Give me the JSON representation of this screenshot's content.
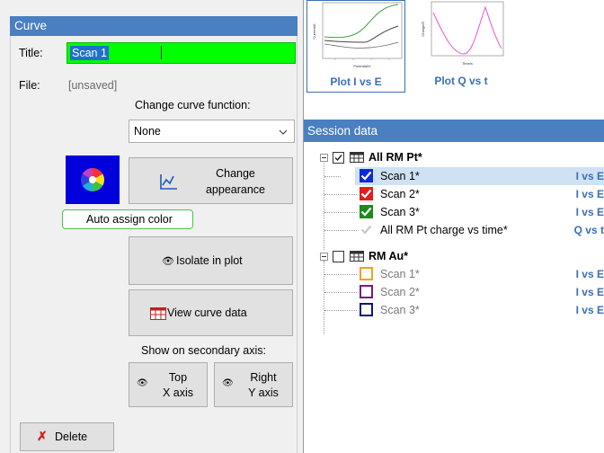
{
  "thumbnails": [
    {
      "label": "Plot I vs E",
      "xlabel": "Potential/V",
      "ylabel": "Current/A"
    },
    {
      "label": "Plot Q vs t",
      "xlabel": "Time/s",
      "ylabel": "Charge/C"
    }
  ],
  "session": {
    "header": "Session data",
    "groups": [
      {
        "name": "All RM Pt*",
        "checked": true,
        "items": [
          {
            "name": "Scan 1*",
            "plot": "I vs E",
            "color": "#0b2bd6",
            "checked": true,
            "selected": true,
            "dim": false
          },
          {
            "name": "Scan 2*",
            "plot": "I vs E",
            "color": "#e41c1c",
            "checked": true,
            "selected": false,
            "dim": false
          },
          {
            "name": "Scan 3*",
            "plot": "I vs E",
            "color": "#1c8a1c",
            "checked": true,
            "selected": false,
            "dim": false
          },
          {
            "name": "All RM Pt charge vs time*",
            "plot": "Q vs t",
            "color": "#c8c8c8",
            "checked": true,
            "selected": false,
            "dim": false
          }
        ]
      },
      {
        "name": "RM Au*",
        "checked": false,
        "items": [
          {
            "name": "Scan 1*",
            "plot": "I vs E",
            "color": "#f0a020",
            "checked": false,
            "selected": false,
            "dim": true
          },
          {
            "name": "Scan 2*",
            "plot": "I vs E",
            "color": "#7a1c7a",
            "checked": false,
            "selected": false,
            "dim": true
          },
          {
            "name": "Scan 3*",
            "plot": "I vs E",
            "color": "#14147a",
            "checked": false,
            "selected": false,
            "dim": true
          }
        ]
      }
    ]
  },
  "curve": {
    "header": "Curve",
    "title_label": "Title:",
    "title_value": "Scan 1",
    "file_label": "File:",
    "file_value": "[unsaved]",
    "change_function_label": "Change curve function:",
    "function_selected": "None",
    "change_appearance_line1": "Change",
    "change_appearance_line2": "appearance",
    "auto_assign_label": "Auto assign color",
    "auto_assign_checked": true,
    "isolate_label": "Isolate in plot",
    "view_data_label": "View curve data",
    "secondary_axis_label": "Show on secondary axis:",
    "top_axis_line1": "Top",
    "top_axis_line2": "X axis",
    "right_axis_line1": "Right",
    "right_axis_line2": "Y axis",
    "delete_label": "Delete"
  },
  "colors": {
    "accent": "#4a7fc1",
    "title_field": "#00ff00",
    "selection": "#cfe2f3",
    "plot_tag": "#3a6fb7"
  }
}
